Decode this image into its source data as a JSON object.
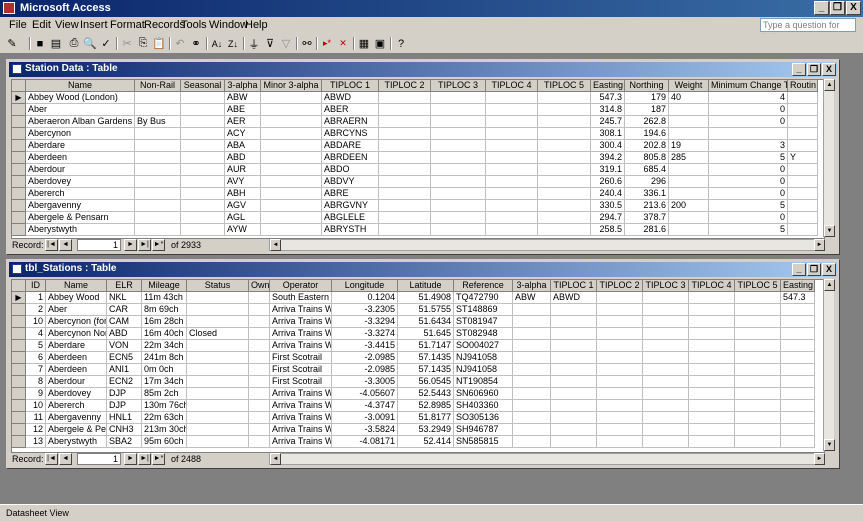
{
  "app": {
    "title": "Microsoft Access"
  },
  "window_controls": {
    "minimize": "_",
    "restore": "❐",
    "close": "X"
  },
  "menu": {
    "items": [
      "File",
      "Edit",
      "View",
      "Insert",
      "Format",
      "Records",
      "Tools",
      "Window",
      "Help"
    ],
    "help_placeholder": "Type a question for help",
    "mdi_controls": [
      "_",
      "❐",
      "×"
    ]
  },
  "toolbar": {
    "buttons": [
      "view-icon",
      "save-icon",
      "print-preview-icon",
      "print-icon",
      "spelling-icon",
      "cut-icon",
      "copy-icon",
      "paste-icon",
      "undo-icon",
      "hyperlink-icon",
      "sort-ascending-icon",
      "sort-descending-icon",
      "filter-by-selection-icon",
      "filter-by-form-icon",
      "apply-filter-icon",
      "find-icon",
      "new-record-icon",
      "delete-record-icon",
      "database-window-icon",
      "new-object-icon",
      "help-icon"
    ]
  },
  "station_data": {
    "title": "Station Data : Table",
    "columns": [
      "Name",
      "Non-Rail",
      "Seasonal",
      "3-alpha",
      "Minor 3-alpha",
      "TIPLOC 1",
      "TIPLOC 2",
      "TIPLOC 3",
      "TIPLOC 4",
      "TIPLOC 5",
      "Easting",
      "Northing",
      "Weight",
      "Minimum Change Time",
      "Routin"
    ],
    "rows": [
      [
        "Abbey Wood (London)",
        "",
        "",
        "ABW",
        "",
        "ABWD",
        "",
        "",
        "",
        "",
        "547.3",
        "179",
        "40",
        "4",
        ""
      ],
      [
        "Aber",
        "",
        "",
        "ABE",
        "",
        "ABER",
        "",
        "",
        "",
        "",
        "314.8",
        "187",
        "",
        "0",
        ""
      ],
      [
        "Aberaeron Alban Gardens",
        "By Bus",
        "",
        "AER",
        "",
        "ABRAERN",
        "",
        "",
        "",
        "",
        "245.7",
        "262.8",
        "",
        "0",
        ""
      ],
      [
        "Abercynon",
        "",
        "",
        "ACY",
        "",
        "ABRCYNS",
        "",
        "",
        "",
        "",
        "308.1",
        "194.6",
        "",
        "",
        ""
      ],
      [
        "Aberdare",
        "",
        "",
        "ABA",
        "",
        "ABDARE",
        "",
        "",
        "",
        "",
        "300.4",
        "202.8",
        "19",
        "3",
        ""
      ],
      [
        "Aberdeen",
        "",
        "",
        "ABD",
        "",
        "ABRDEEN",
        "",
        "",
        "",
        "",
        "394.2",
        "805.8",
        "285",
        "5",
        "Y"
      ],
      [
        "Aberdour",
        "",
        "",
        "AUR",
        "",
        "ABDO",
        "",
        "",
        "",
        "",
        "319.1",
        "685.4",
        "",
        "0",
        ""
      ],
      [
        "Aberdovey",
        "",
        "",
        "AVY",
        "",
        "ABDVY",
        "",
        "",
        "",
        "",
        "260.6",
        "296",
        "",
        "0",
        ""
      ],
      [
        "Abererch",
        "",
        "",
        "ABH",
        "",
        "ABRE",
        "",
        "",
        "",
        "",
        "240.4",
        "336.1",
        "",
        "0",
        ""
      ],
      [
        "Abergavenny",
        "",
        "",
        "AGV",
        "",
        "ABRGVNY",
        "",
        "",
        "",
        "",
        "330.5",
        "213.6",
        "200",
        "5",
        ""
      ],
      [
        "Abergele & Pensarn",
        "",
        "",
        "AGL",
        "",
        "ABGLELE",
        "",
        "",
        "",
        "",
        "294.7",
        "378.7",
        "",
        "0",
        ""
      ],
      [
        "Aberystwyth",
        "",
        "",
        "AYW",
        "",
        "ABRYSTH",
        "",
        "",
        "",
        "",
        "258.5",
        "281.6",
        "",
        "5",
        ""
      ]
    ],
    "record_label": "Record:",
    "record_current": "1",
    "record_total": "of  2933"
  },
  "tbl_stations": {
    "title": "tbl_Stations : Table",
    "columns": [
      "ID",
      "Name",
      "ELR",
      "Mileage",
      "Status",
      "Own",
      "Operator",
      "Longitude",
      "Latitude",
      "Reference",
      "3-alpha",
      "TIPLOC 1",
      "TIPLOC 2",
      "TIPLOC 3",
      "TIPLOC 4",
      "TIPLOC 5",
      "Easting"
    ],
    "rows": [
      [
        "1",
        "Abbey Wood",
        "NKL",
        "11m 43ch",
        "",
        "",
        "South Eastern",
        "0.1204",
        "51.4908",
        "TQ472790",
        "ABW",
        "ABWD",
        "",
        "",
        "",
        "",
        "547.3"
      ],
      [
        "2",
        "Aber",
        "CAR",
        "8m 69ch",
        "",
        "",
        "Arriva Trains W",
        "-3.2305",
        "51.5755",
        "ST148869",
        "",
        "",
        "",
        "",
        "",
        "",
        ""
      ],
      [
        "10",
        "Abercynon (form",
        "CAM",
        "16m 28ch",
        "",
        "",
        "Arriva Trains W",
        "-3.3294",
        "51.6434",
        "ST081947",
        "",
        "",
        "",
        "",
        "",
        "",
        ""
      ],
      [
        "4",
        "Abercynon Nort",
        "ABD",
        "16m 40ch",
        "Closed",
        "",
        "Arriva Trains W",
        "-3.3274",
        "51.645",
        "ST082948",
        "",
        "",
        "",
        "",
        "",
        "",
        ""
      ],
      [
        "5",
        "Aberdare",
        "VON",
        "22m 34ch",
        "",
        "",
        "Arriva Trains W",
        "-3.4415",
        "51.7147",
        "SO004027",
        "",
        "",
        "",
        "",
        "",
        "",
        ""
      ],
      [
        "6",
        "Aberdeen",
        "ECN5",
        "241m 8ch",
        "",
        "",
        "First Scotrail",
        "-2.0985",
        "57.1435",
        "NJ941058",
        "",
        "",
        "",
        "",
        "",
        "",
        ""
      ],
      [
        "7",
        "Aberdeen",
        "ANI1",
        "0m 0ch",
        "",
        "",
        "First Scotrail",
        "-2.0985",
        "57.1435",
        "NJ941058",
        "",
        "",
        "",
        "",
        "",
        "",
        ""
      ],
      [
        "8",
        "Aberdour",
        "ECN2",
        "17m 34ch",
        "",
        "",
        "First Scotrail",
        "-3.3005",
        "56.0545",
        "NT190854",
        "",
        "",
        "",
        "",
        "",
        "",
        ""
      ],
      [
        "9",
        "Aberdovey",
        "DJP",
        "85m 2ch",
        "",
        "",
        "Arriva Trains W",
        "-4.05607",
        "52.5443",
        "SN606960",
        "",
        "",
        "",
        "",
        "",
        "",
        ""
      ],
      [
        "10",
        "Abererch",
        "DJP",
        "130m 76ch",
        "",
        "",
        "Arriva Trains W",
        "-4.3747",
        "52.8985",
        "SH403360",
        "",
        "",
        "",
        "",
        "",
        "",
        ""
      ],
      [
        "11",
        "Abergavenny",
        "HNL1",
        "22m 63ch",
        "",
        "",
        "Arriva Trains W",
        "-3.0091",
        "51.8177",
        "SO305136",
        "",
        "",
        "",
        "",
        "",
        "",
        ""
      ],
      [
        "12",
        "Abergele & Per",
        "CNH3",
        "213m 30ch",
        "",
        "",
        "Arriva Trains W",
        "-3.5824",
        "53.2949",
        "SH946787",
        "",
        "",
        "",
        "",
        "",
        "",
        ""
      ],
      [
        "13",
        "Aberystwyth",
        "SBA2",
        "95m 60ch",
        "",
        "",
        "Arriva Trains W",
        "-4.08171",
        "52.414",
        "SN585815",
        "",
        "",
        "",
        "",
        "",
        "",
        ""
      ]
    ],
    "record_label": "Record:",
    "record_current": "1",
    "record_total": "of  2488"
  },
  "nav_glyphs": {
    "first": "|◄",
    "prev": "◄",
    "next": "►",
    "last": "►|",
    "new": "►*"
  },
  "status": {
    "text": "Datasheet View"
  }
}
